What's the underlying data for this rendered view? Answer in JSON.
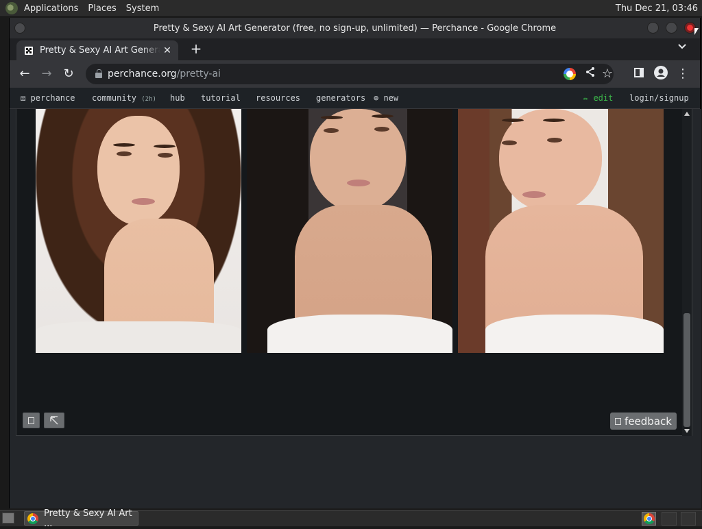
{
  "panel": {
    "menus": [
      "Applications",
      "Places",
      "System"
    ],
    "clock": "Thu Dec 21, 03:46"
  },
  "window": {
    "title": "Pretty & Sexy AI Art Generator (free, no sign-up, unlimited) — Perchance - Google Chrome"
  },
  "browser": {
    "tab_title": "Pretty & Sexy AI Art Generator (free, no sign-up, unlimited)",
    "tab_close": "✕",
    "new_tab": "+",
    "tab_list": "⌄",
    "url_host": "perchance.org",
    "url_path": "/pretty-ai",
    "back": "←",
    "forward": "→",
    "reload": "↻",
    "share": "⋖",
    "star": "☆",
    "menu": "⋮"
  },
  "site_nav": {
    "logo_label": "perchance",
    "community": "community",
    "community_badge": "(2h)",
    "hub": "hub",
    "tutorial": "tutorial",
    "resources": "resources",
    "generators": "generators",
    "new": "new",
    "edit": "✏ edit",
    "login": "login/signup"
  },
  "gallery": {
    "image_count": 3,
    "feedback_label": "feedback"
  },
  "taskbar": {
    "task_label": "Pretty & Sexy AI Art ..."
  },
  "colors": {
    "accent_edit": "#3cb84a",
    "chrome_bg": "#35363a",
    "page_bg": "#15181b"
  }
}
